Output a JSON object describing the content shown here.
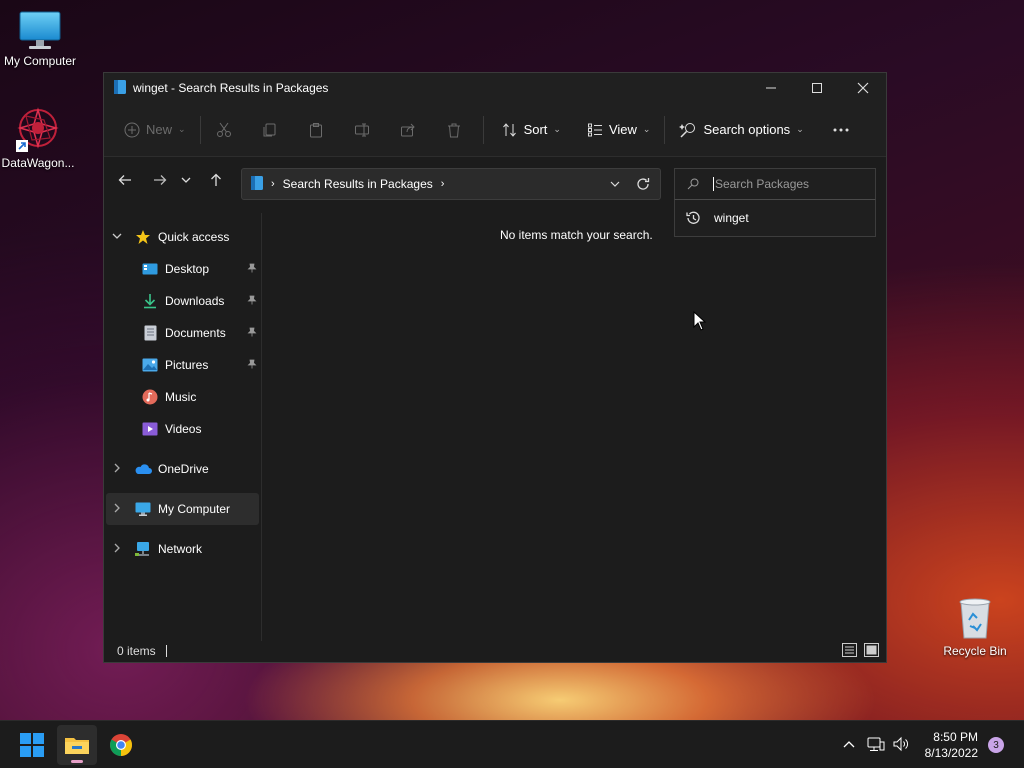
{
  "desktop": {
    "icons": [
      {
        "label": "My Computer"
      },
      {
        "label": "DataWagon..."
      },
      {
        "label": "Recycle Bin"
      }
    ]
  },
  "window": {
    "title": "winget - Search Results in Packages",
    "toolbar": {
      "new_label": "New",
      "sort_label": "Sort",
      "view_label": "View",
      "search_options_label": "Search options"
    },
    "address": {
      "path": "Search Results in Packages"
    },
    "search": {
      "placeholder": "Search Packages",
      "suggestion": "winget"
    },
    "sidebar": {
      "quick_access": "Quick access",
      "items": [
        {
          "label": "Desktop",
          "icon": "desktop-icon",
          "pinned": true
        },
        {
          "label": "Downloads",
          "icon": "download-icon",
          "pinned": true
        },
        {
          "label": "Documents",
          "icon": "document-icon",
          "pinned": true
        },
        {
          "label": "Pictures",
          "icon": "pictures-icon",
          "pinned": true
        },
        {
          "label": "Music",
          "icon": "music-icon",
          "pinned": false
        },
        {
          "label": "Videos",
          "icon": "videos-icon",
          "pinned": false
        }
      ],
      "onedrive": "OneDrive",
      "my_computer": "My Computer",
      "network": "Network"
    },
    "content": {
      "empty_message": "No items match your search."
    },
    "status": {
      "item_count": "0 items"
    }
  },
  "taskbar": {
    "time": "8:50 PM",
    "date": "8/13/2022",
    "notification_count": "3"
  },
  "colors": {
    "accent": "#0078d4",
    "window_bg": "#1c1c1c",
    "taskbar_bg": "#1c1c1c"
  }
}
